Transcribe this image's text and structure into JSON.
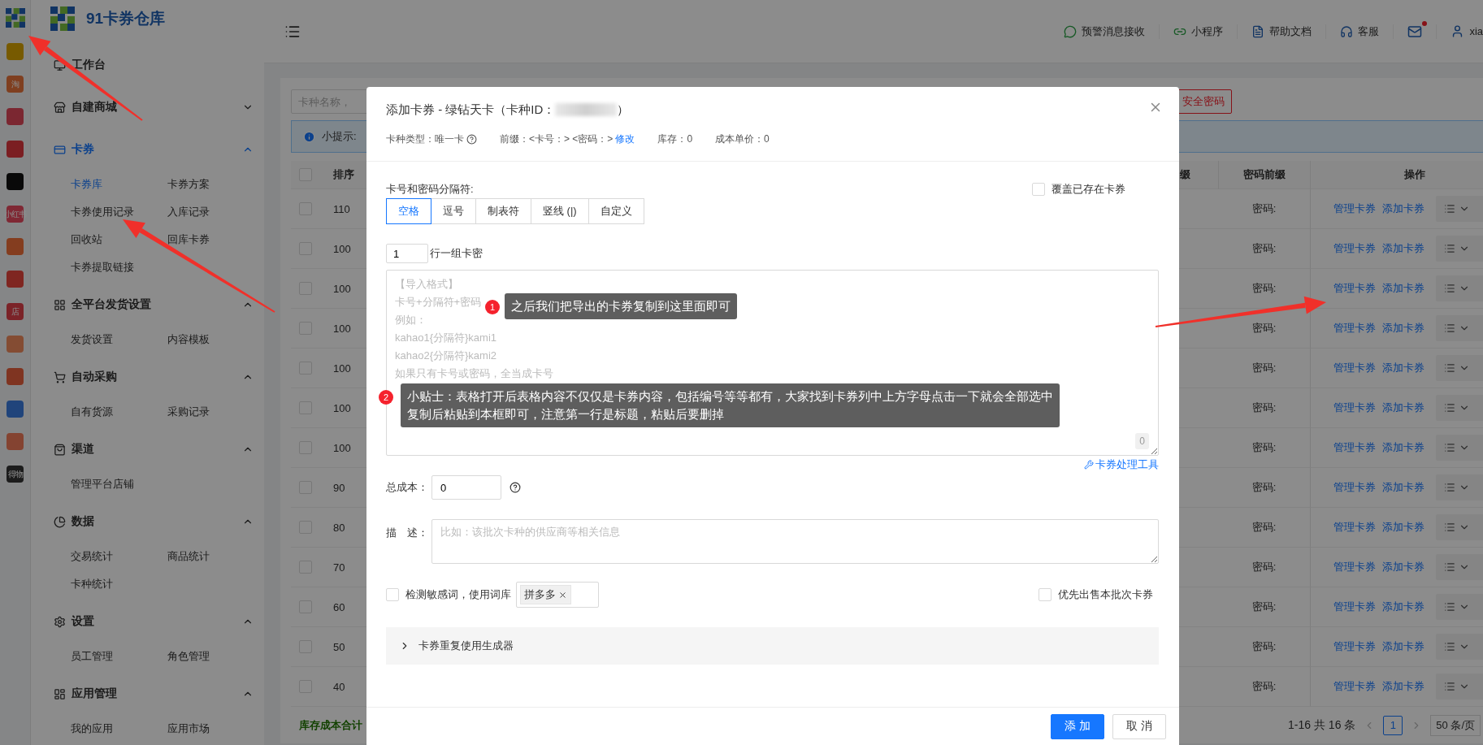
{
  "rail": [
    {
      "kind": "logo"
    },
    {
      "kind": "text",
      "label": "淘"
    },
    {
      "kind": "logo"
    },
    {
      "kind": "logo"
    },
    {
      "kind": "logo"
    },
    {
      "kind": "text",
      "label": "小红书"
    },
    {
      "kind": "logo"
    },
    {
      "kind": "logo"
    },
    {
      "kind": "text",
      "label": "店"
    },
    {
      "kind": "logo"
    },
    {
      "kind": "logo"
    },
    {
      "kind": "logo"
    },
    {
      "kind": "logo"
    },
    {
      "kind": "text",
      "label": "得物"
    }
  ],
  "brand": "91卡券仓库",
  "nav": [
    {
      "kind": "link",
      "label": "工作台",
      "selected": false
    },
    {
      "kind": "group",
      "label": "自建商城",
      "selected": false,
      "expanded": false
    },
    {
      "kind": "group",
      "label": "卡券",
      "selected": true,
      "expanded": true,
      "children": [
        {
          "label": "卡券库",
          "selected": true
        },
        {
          "label": "卡券方案",
          "selected": false
        },
        {
          "label": "卡券使用记录",
          "selected": false
        },
        {
          "label": "入库记录",
          "selected": false
        },
        {
          "label": "回收站",
          "selected": false
        },
        {
          "label": "回库卡券",
          "selected": false
        },
        {
          "label": "卡券提取链接",
          "selected": false
        }
      ]
    },
    {
      "kind": "group",
      "label": "全平台发货设置",
      "selected": false,
      "expanded": true,
      "children": [
        {
          "label": "发货设置",
          "selected": false
        },
        {
          "label": "内容模板",
          "selected": false
        }
      ]
    },
    {
      "kind": "group",
      "label": "自动采购",
      "selected": false,
      "expanded": true,
      "children": [
        {
          "label": "自有货源",
          "selected": false
        },
        {
          "label": "采购记录",
          "selected": false
        }
      ]
    },
    {
      "kind": "group",
      "label": "渠道",
      "selected": false,
      "expanded": true,
      "children": [
        {
          "label": "管理平台店铺",
          "selected": false
        }
      ]
    },
    {
      "kind": "group",
      "label": "数据",
      "selected": false,
      "expanded": true,
      "children": [
        {
          "label": "交易统计",
          "selected": false
        },
        {
          "label": "商品统计",
          "selected": false
        },
        {
          "label": "卡种统计",
          "selected": false
        }
      ]
    },
    {
      "kind": "group",
      "label": "设置",
      "selected": false,
      "expanded": true,
      "children": [
        {
          "label": "员工管理",
          "selected": false
        },
        {
          "label": "角色管理",
          "selected": false
        }
      ]
    },
    {
      "kind": "group",
      "label": "应用管理",
      "selected": false,
      "expanded": true,
      "children": [
        {
          "label": "我的应用",
          "selected": false
        },
        {
          "label": "应用市场",
          "selected": false
        }
      ]
    }
  ],
  "header": {
    "items": [
      {
        "label": "预警消息接收"
      },
      {
        "label": "小程序"
      },
      {
        "label": "帮助文档"
      },
      {
        "label": "客服"
      }
    ],
    "mail_unread": true,
    "user": "xia"
  },
  "search": {
    "placeholder": "卡种名称，"
  },
  "password_button": "安全密码",
  "tip": "小提示:",
  "table": {
    "all_checked": false,
    "columns": [
      "排序",
      "缀",
      "密码前缀",
      "操作"
    ],
    "rows": [
      {
        "checked": false,
        "sort": "110",
        "password_prefix": "密码:",
        "actions": [
          "管理卡券",
          "添加卡券"
        ]
      },
      {
        "checked": false,
        "sort": "100",
        "password_prefix": "密码:",
        "actions": [
          "管理卡券",
          "添加卡券"
        ]
      },
      {
        "checked": false,
        "sort": "100",
        "password_prefix": "密码:",
        "actions": [
          "管理卡券",
          "添加卡券"
        ]
      },
      {
        "checked": false,
        "sort": "100",
        "password_prefix": "密码:",
        "actions": [
          "管理卡券",
          "添加卡券"
        ]
      },
      {
        "checked": false,
        "sort": "100",
        "password_prefix": "密码:",
        "actions": [
          "管理卡券",
          "添加卡券"
        ]
      },
      {
        "checked": false,
        "sort": "100",
        "password_prefix": "密码:",
        "actions": [
          "管理卡券",
          "添加卡券"
        ]
      },
      {
        "checked": false,
        "sort": "100",
        "password_prefix": "密码:",
        "actions": [
          "管理卡券",
          "添加卡券"
        ]
      },
      {
        "checked": false,
        "sort": "90",
        "password_prefix": "密码:",
        "actions": [
          "管理卡券",
          "添加卡券"
        ]
      },
      {
        "checked": false,
        "sort": "80",
        "password_prefix": "密码:",
        "actions": [
          "管理卡券",
          "添加卡券"
        ]
      },
      {
        "checked": false,
        "sort": "70",
        "password_prefix": "密码:",
        "actions": [
          "管理卡券",
          "添加卡券"
        ]
      },
      {
        "checked": false,
        "sort": "60",
        "password_prefix": "密码:",
        "actions": [
          "管理卡券",
          "添加卡券"
        ]
      },
      {
        "checked": false,
        "sort": "50",
        "password_prefix": "密码:",
        "actions": [
          "管理卡券",
          "添加卡券"
        ]
      },
      {
        "checked": false,
        "sort": "40",
        "password_prefix": "密码:",
        "actions": [
          "管理卡券",
          "添加卡券"
        ]
      }
    ]
  },
  "footer": {
    "total": "库存成本合计",
    "range": "1-16 共 16 条",
    "pages": [
      {
        "label": "1",
        "selected": true
      }
    ],
    "page_size": "50 条/页"
  },
  "modal": {
    "title": "添加卡券 - 绿钻天卡（卡种ID：",
    "title_end": "）",
    "info": [
      {
        "text": "卡种类型：唯一卡",
        "help": true
      },
      {
        "text": "前缀：<卡号：> <密码：>",
        "link": "修改"
      },
      {
        "text": "库存：0"
      },
      {
        "text": "成本单价：0"
      }
    ],
    "separator_label": "卡号和密码分隔符:",
    "separators": [
      {
        "label": "空格",
        "selected": true
      },
      {
        "label": "逗号",
        "selected": false
      },
      {
        "label": "制表符",
        "selected": false
      },
      {
        "label": "竖线 (|)",
        "selected": false
      },
      {
        "label": "自定义",
        "selected": false
      }
    ],
    "overwrite": {
      "label": "覆盖已存在卡券",
      "checked": false
    },
    "lines_per_group": {
      "value": "1",
      "label": "行一组卡密"
    },
    "cards": {
      "placeholder": [
        "【导入格式】",
        "卡号+分隔符+密码",
        "例如：",
        "kahao1{分隔符}kami1",
        "kahao2{分隔符}kami2",
        "如果只有卡号或密码，全当成卡号"
      ],
      "count": "0"
    },
    "callouts": [
      {
        "number": "1",
        "lines": [
          "之后我们把导出的卡券复制到这里面即可"
        ]
      },
      {
        "number": "2",
        "lines": [
          "小贴士：表格打开后表格内容不仅仅是卡券内容，包括编号等等都有，大家找到卡券列中上方字母点击一下就会全部选中",
          "复制后粘贴到本框即可，注意第一行是标题，粘贴后要删掉"
        ]
      }
    ],
    "tool_link": "卡券处理工具",
    "total_cost": {
      "label": "总成本：",
      "value": "0"
    },
    "description": {
      "label": "描　述：",
      "placeholder": "比如：该批次卡种的供应商等相关信息"
    },
    "sensitive": {
      "label": "检测敏感词，使用词库",
      "checked": false,
      "tags": [
        "拼多多"
      ]
    },
    "priority": {
      "label": "优先出售本批次卡券",
      "checked": false
    },
    "generator": {
      "label": "卡券重复使用生成器",
      "expanded": false
    },
    "buttons": [
      {
        "label": "添 加",
        "kind": "primary"
      },
      {
        "label": "取 消",
        "kind": "default"
      }
    ]
  }
}
